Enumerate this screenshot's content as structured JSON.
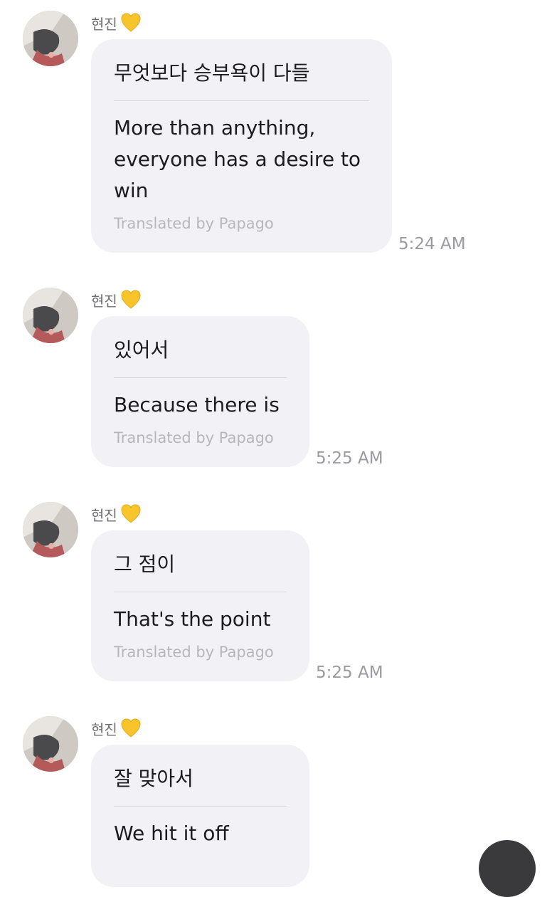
{
  "messages": [
    {
      "sender": "현진",
      "original": "무엇보다 승부욕이 다들",
      "translated_lines": [
        "More than anything,",
        "everyone has a desire to",
        "win"
      ],
      "credit": "Translated by Papago",
      "time": "5:24 AM"
    },
    {
      "sender": "현진",
      "original": "있어서",
      "translated_lines": [
        "Because there is"
      ],
      "credit": "Translated by Papago",
      "time": "5:25 AM"
    },
    {
      "sender": "현진",
      "original": "그 점이",
      "translated_lines": [
        "That's the point"
      ],
      "credit": "Translated by Papago",
      "time": "5:25 AM"
    },
    {
      "sender": "현진",
      "original": "잘 맞아서",
      "translated_lines": [
        "We hit it off"
      ],
      "credit": "",
      "time": ""
    }
  ],
  "colors": {
    "bubble": "#f2f2f6",
    "heart": "#f7c52b",
    "timestamp": "#9a9aa1",
    "credit": "#b6b6bd"
  },
  "icons": {
    "sender_badge": "yellow-heart-icon",
    "floating_button": "scroll-down-button"
  }
}
